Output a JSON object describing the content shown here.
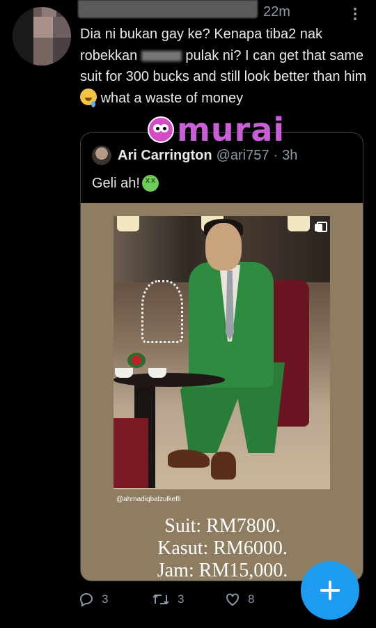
{
  "tweet": {
    "time": "22m",
    "text_before": "Dia ni bukan gay ke? Kenapa tiba2 nak robekkan",
    "text_after": "pulak ni? I can get that same suit for 300 bucks and still look better than him",
    "text_end": "what a waste of money",
    "emoji": "tear-smile-emoji"
  },
  "watermark": {
    "text": "murai"
  },
  "quoted_tweet": {
    "name": "Ari Carrington",
    "handle": "@ari757",
    "separator": "·",
    "time": "3h",
    "text": "Geli ah!",
    "emoji": "nauseated-face-emoji",
    "media": {
      "credit": "@ahmadiqbalzulkefli",
      "prices": [
        "Suit: RM7800.",
        "Kasut: RM6000.",
        "Jam: RM15,000."
      ]
    }
  },
  "actions": {
    "replies": "3",
    "retweets": "3",
    "likes": "8"
  },
  "colors": {
    "accent": "#1d9bf0",
    "text_secondary": "#8b98a5",
    "background": "#000000"
  },
  "icons": [
    "more-icon",
    "reply-icon",
    "retweet-icon",
    "like-icon",
    "compose-icon",
    "copy-icon"
  ]
}
